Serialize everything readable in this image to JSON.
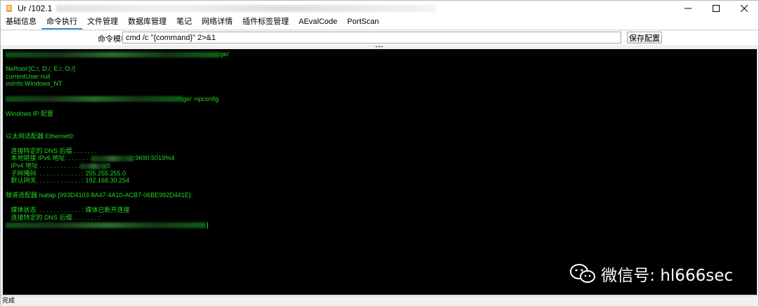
{
  "window": {
    "title": "Ur         /102.1",
    "controls": [
      "minimize",
      "maximize",
      "close"
    ]
  },
  "tabs": [
    {
      "label": "基础信息",
      "active": false
    },
    {
      "label": "命令执行",
      "active": true
    },
    {
      "label": "文件管理",
      "active": false
    },
    {
      "label": "数据库管理",
      "active": false
    },
    {
      "label": "笔记",
      "active": false
    },
    {
      "label": "网络详情",
      "active": false
    },
    {
      "label": "插件标签管理",
      "active": false
    },
    {
      "label": "AEvalCode",
      "active": false
    },
    {
      "label": "PortScan",
      "active": false
    }
  ],
  "command": {
    "label": "命令模板",
    "template": "cmd /c \"{command}\" 2>&1",
    "save_label": "保存配置"
  },
  "terminal": {
    "lines": {
      "path_suffix": "ge/",
      "fileroot": "fileRoot:[C:/, D:/, E:/, O:/]",
      "current_user": "currentUser:null",
      "os_info": "osInfo:Windows_NT",
      "prompt_suffix": "ge/ >ipconfig",
      "windows_ip": "Windows IP 配置",
      "adapter_ethernet": "以太网适配器 Ethernet0:",
      "dns_suffix_1": "   连接特定的 DNS 后缀 . . . . . . .",
      "ipv6_prefix": "   本地链接 IPv6 地址. . . . . . . .",
      "ipv6_suffix": ":9690:5019%4",
      "ipv4_prefix": "   IPv4 地址 . . . . . . . . . . . .",
      "ipv4_suffix": "0",
      "subnet": "   子网掩码  . . . . . . . . . . . . : 255.255.255.0",
      "gateway": "   默认网关. . . . . . . . . . . . . : 192.168.30.254",
      "adapter_tunnel": "隧道适配器 isatap.{993D4103-8A47-4A10-ACB7-06BE992D441E}:",
      "media_state": "   媒体状态  . . . . . . . . . . . . : 媒体已断开连接",
      "dns_suffix_2": "   连接特定的 DNS 后缀 . . . . . . . :"
    }
  },
  "watermark": "微信号: hl666sec",
  "status": "完成",
  "colors": {
    "terminal_bg": "#000000",
    "terminal_fg": "#22d622",
    "tab_active_underline": "#3b8ddb"
  }
}
